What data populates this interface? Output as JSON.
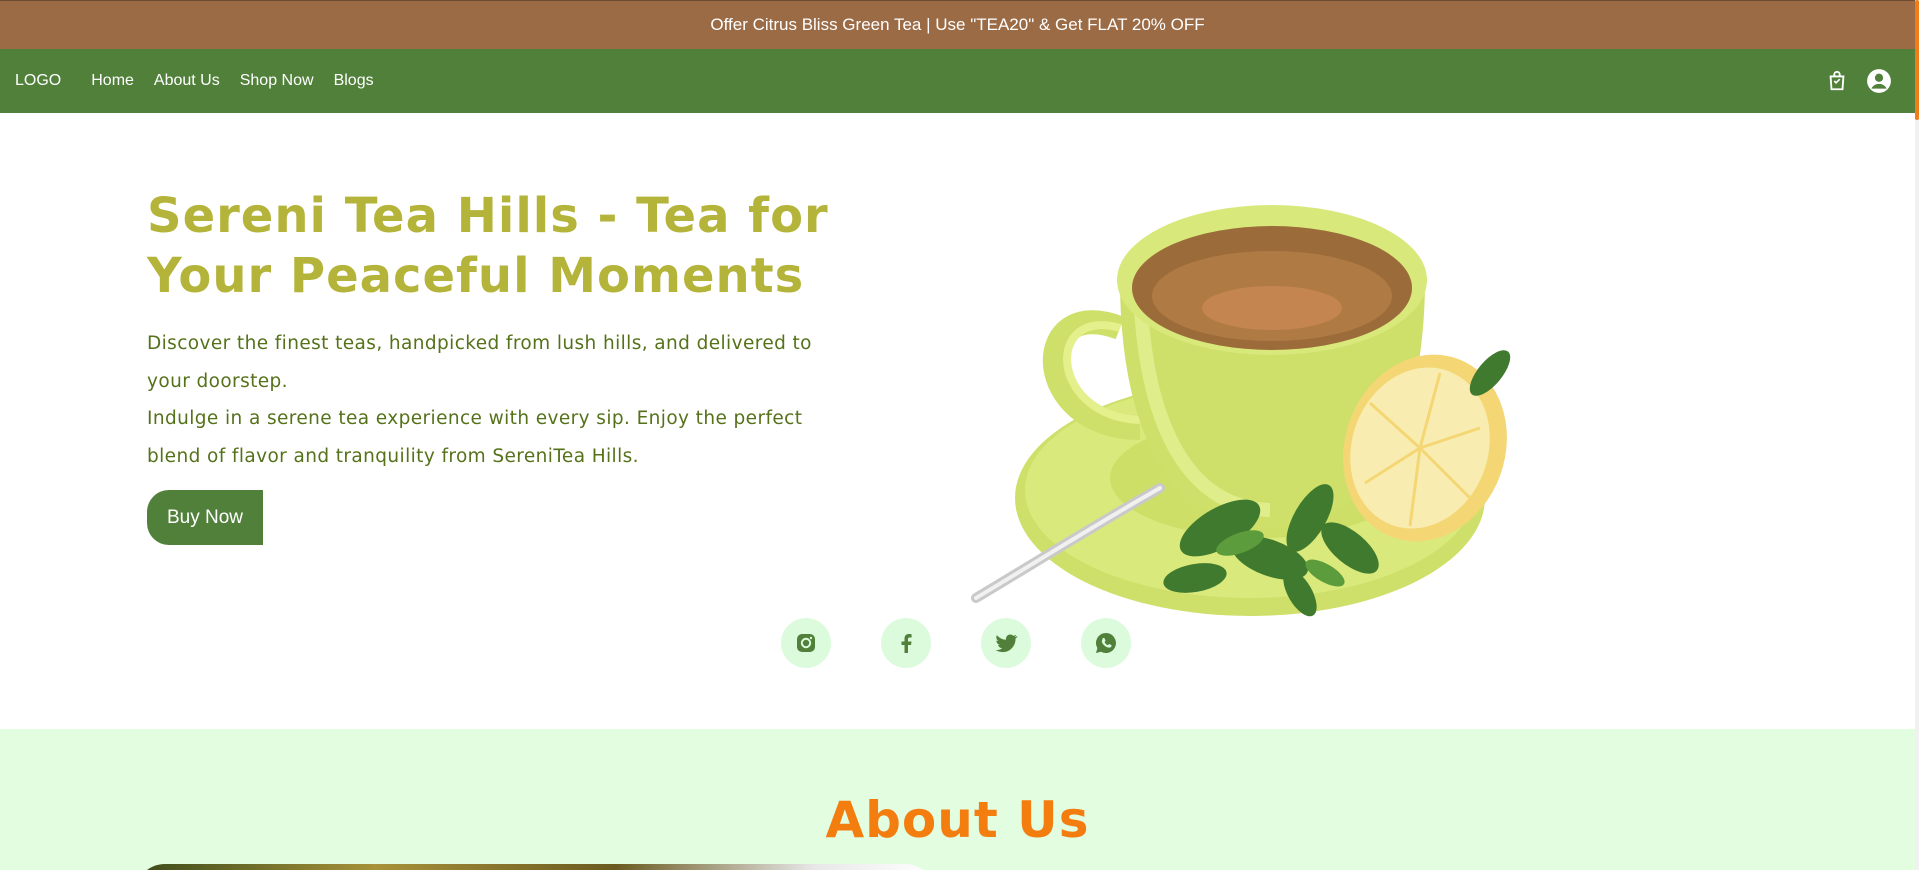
{
  "topbar": {
    "offer_text": "Offer Citrus Bliss Green Tea | Use \"TEA20\" & Get FLAT 20% OFF"
  },
  "navbar": {
    "logo": "LOGO",
    "links": [
      "Home",
      "About Us",
      "Shop Now",
      "Blogs"
    ],
    "icons": [
      "shopping-bag-icon",
      "user-account-icon"
    ]
  },
  "hero": {
    "title": "Sereni Tea Hills - Tea for Your Peaceful Moments",
    "paragraph_1": "Discover the finest teas, handpicked from lush hills, and delivered to your doorstep.",
    "paragraph_2": "Indulge in a serene tea experience with every sip. Enjoy the perfect blend of flavor and tranquility from SereniTea Hills.",
    "buy_button": "Buy Now"
  },
  "socials": [
    "instagram-icon",
    "facebook-icon",
    "twitter-icon",
    "whatsapp-icon"
  ],
  "about": {
    "title": "About Us"
  },
  "colors": {
    "topbar_bg": "#9b6b45",
    "navbar_bg": "#51803b",
    "title_color": "#b4b33a",
    "text_color": "#55721a",
    "about_bg": "#e3fde1",
    "about_title": "#f47d10",
    "social_bg": "#dcfbdc"
  }
}
